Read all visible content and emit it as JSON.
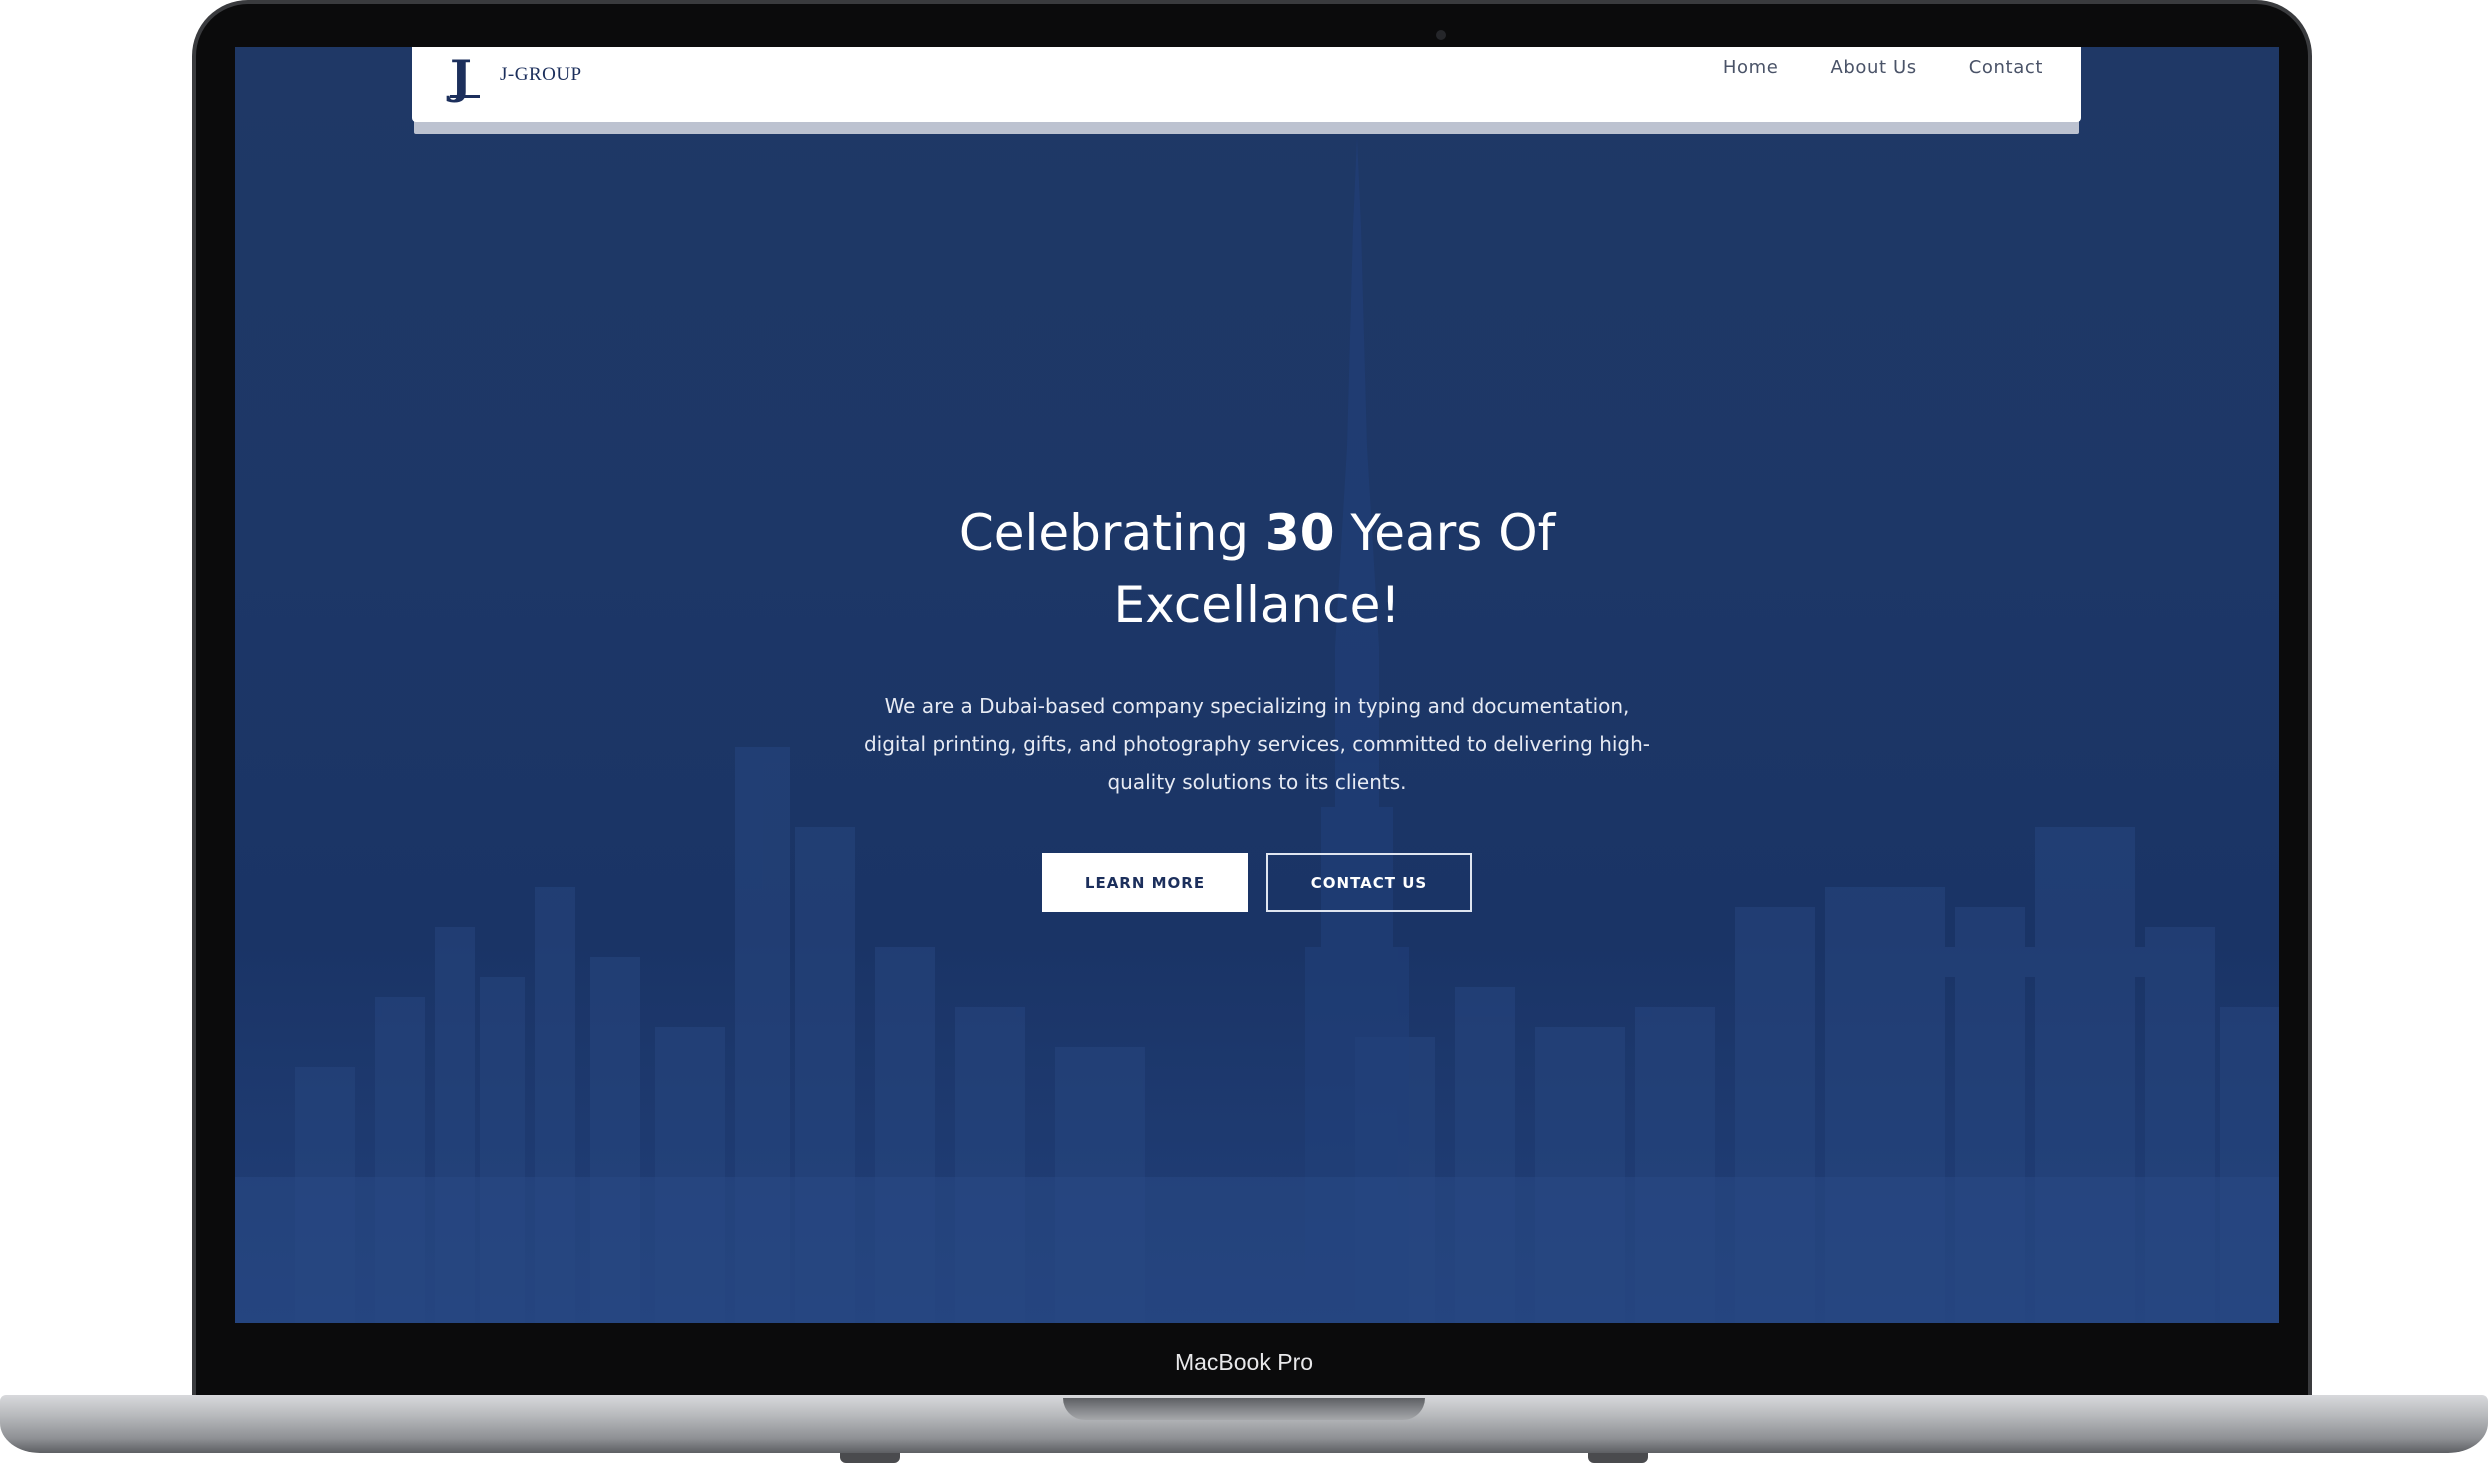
{
  "device": {
    "label": "MacBook Pro"
  },
  "header": {
    "logo_mark": "J",
    "logo_text": "J-GROUP",
    "nav": [
      "Home",
      "About Us",
      "Contact"
    ]
  },
  "hero": {
    "title_pre": "Celebrating ",
    "title_bold": "30",
    "title_post": " Years Of Excellance!",
    "description": "We are a Dubai-based company specializing in typing and documentation, digital printing, gifts, and photography services, committed to delivering high-quality solutions to its clients.",
    "primary_button": "LEARN MORE",
    "secondary_button": "CONTACT US"
  },
  "colors": {
    "hero_background": "#1d3767",
    "brand_navy": "#1c2f5c",
    "header_background": "#ffffff"
  }
}
